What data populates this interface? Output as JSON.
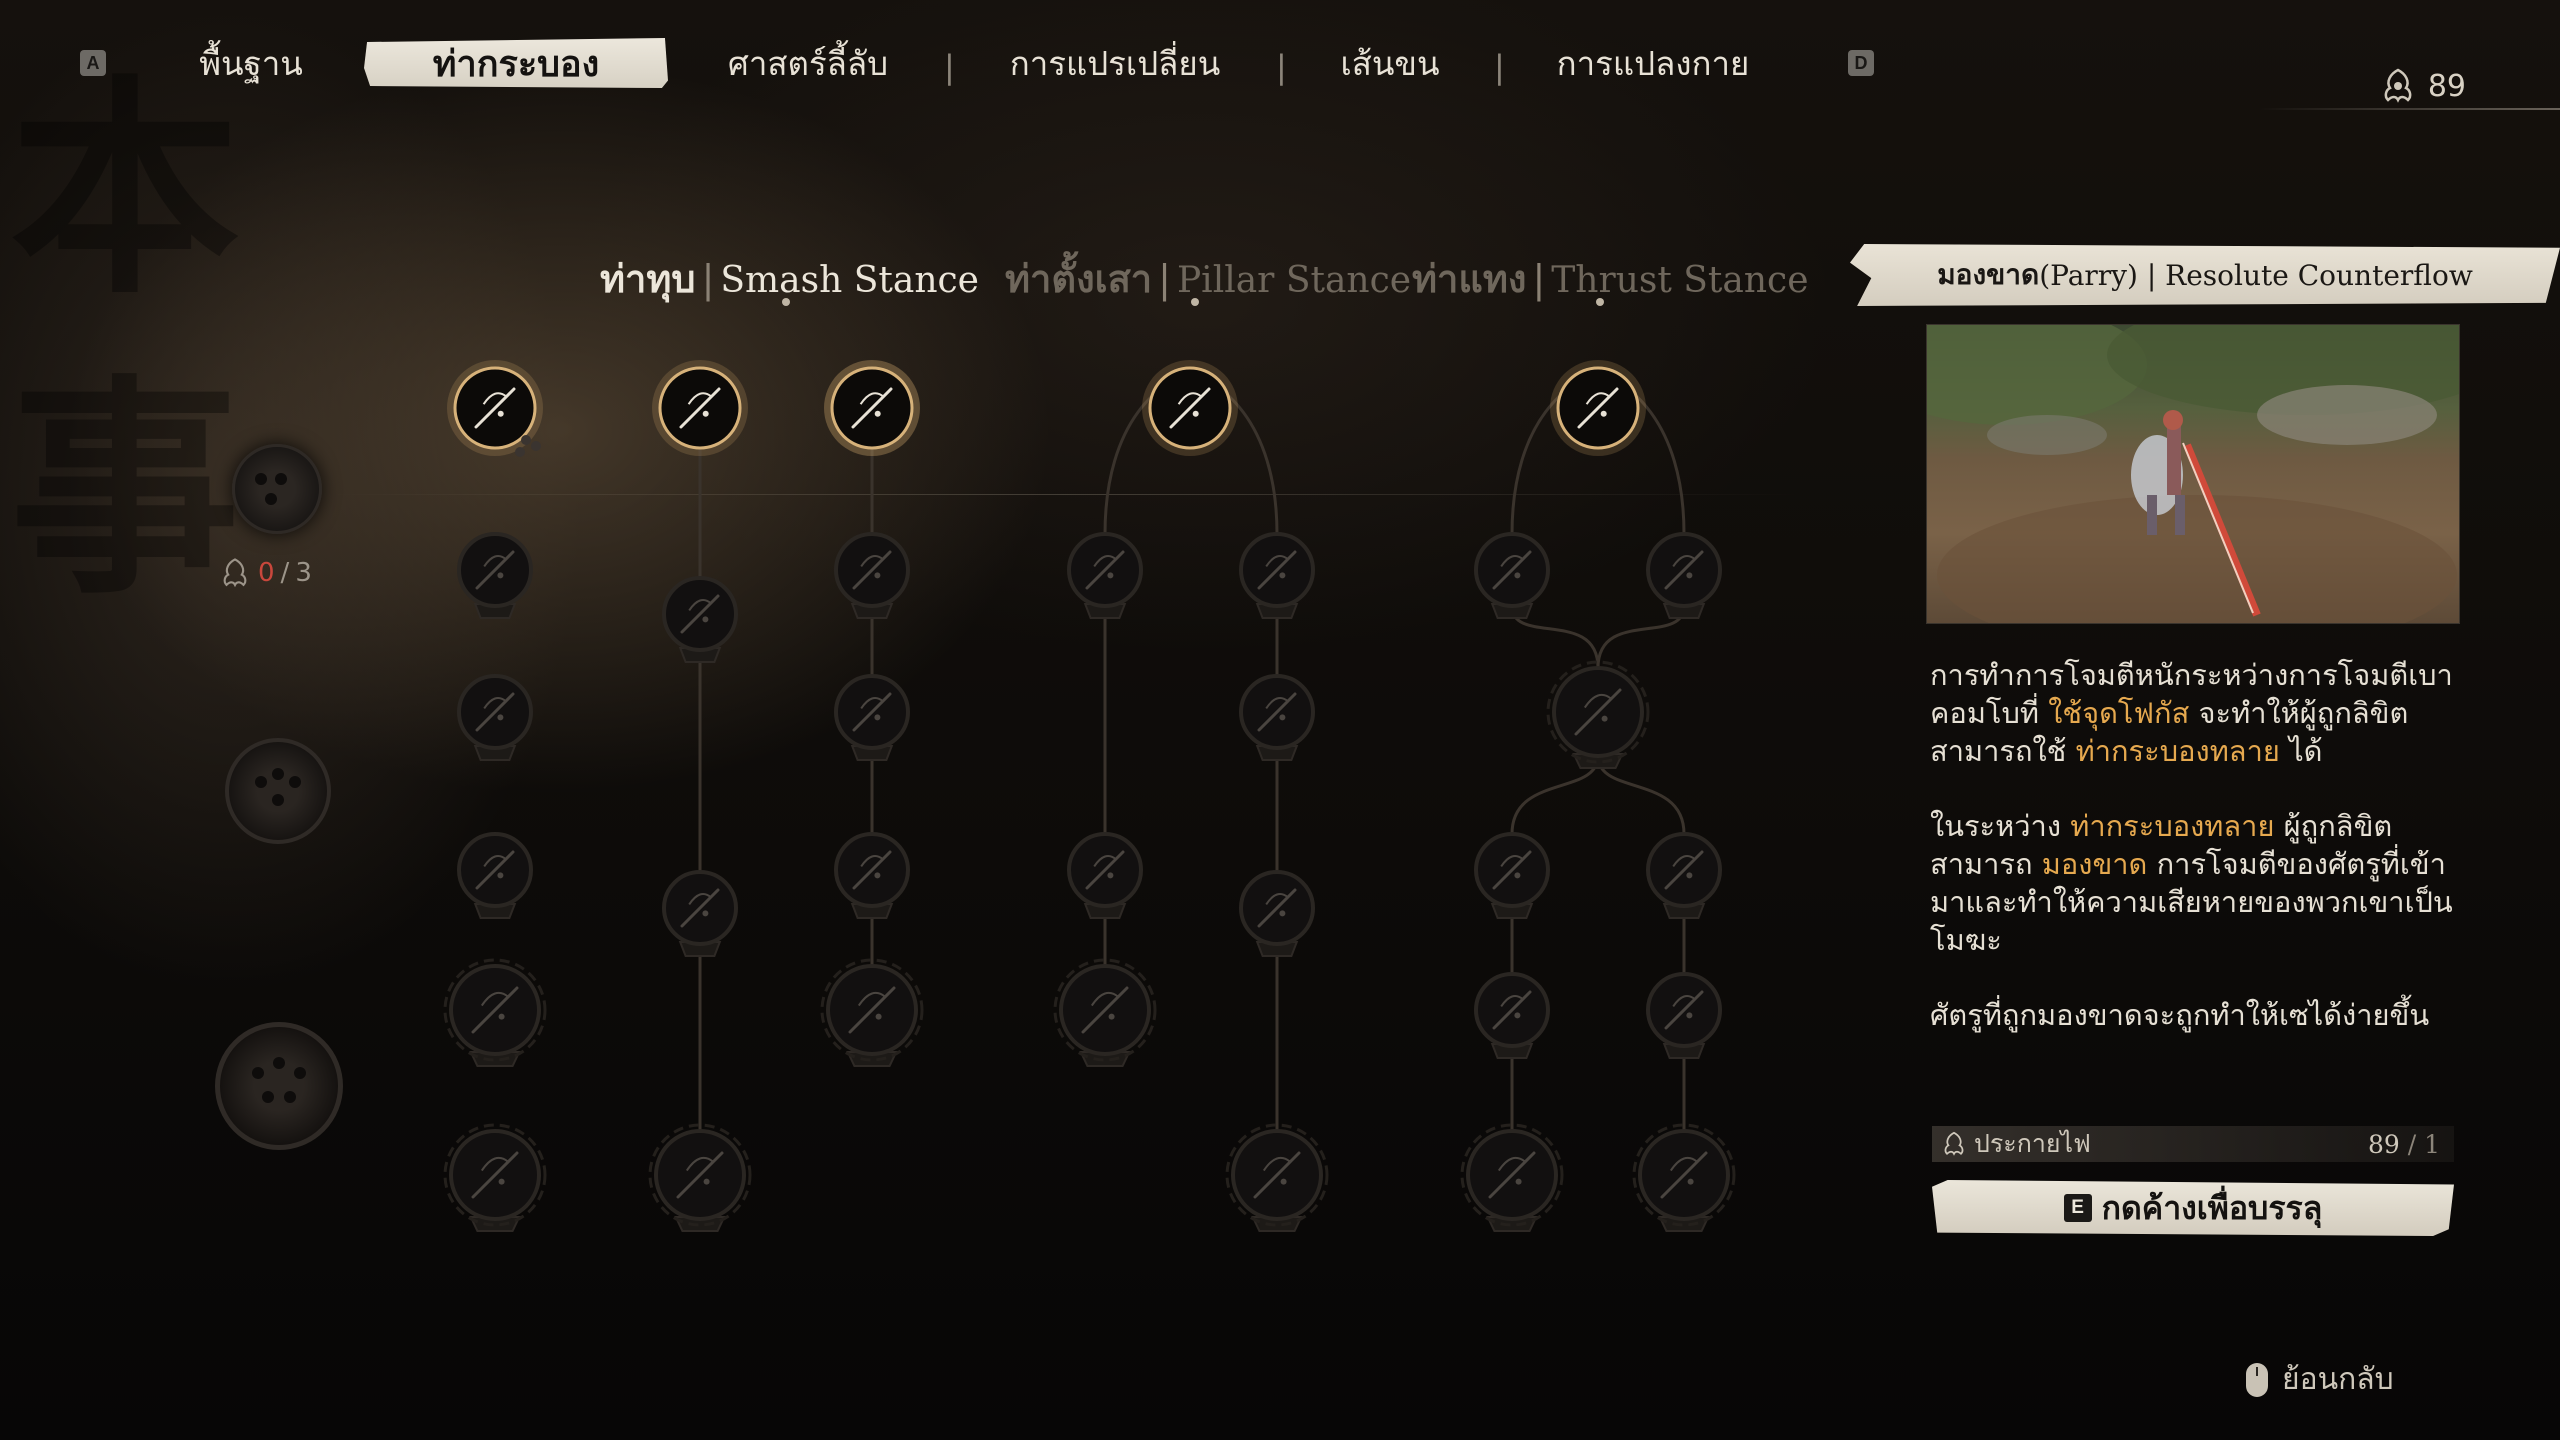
{
  "nav": {
    "left_key": "A",
    "right_key": "D",
    "tabs": [
      {
        "label": "พื้นฐาน",
        "active": false
      },
      {
        "label": "ท่ากระบอง",
        "active": true
      },
      {
        "label": "ศาสตร์ลี้ลับ",
        "active": false
      },
      {
        "label": "การแปรเปลี่ยน",
        "active": false
      },
      {
        "label": "เส้นขน",
        "active": false
      },
      {
        "label": "การแปลงกาย",
        "active": false
      }
    ],
    "separators": [
      "|",
      "|",
      "|"
    ],
    "currency": "89"
  },
  "stances": [
    {
      "th": "ท่าทุบ",
      "en": "Smash Stance",
      "active": true
    },
    {
      "th": "ท่าตั้งเสา",
      "en": "Pillar Stance",
      "active": false
    },
    {
      "th": "ท่าแทง",
      "en": "Thrust Stance",
      "active": false
    }
  ],
  "stance_separator": "|",
  "slots": {
    "count_current": "0",
    "count_sep": "/",
    "count_max": "3"
  },
  "tree": {
    "nodes": [
      {
        "id": "s1a",
        "state": "unlocked",
        "icon": "hook-icon"
      },
      {
        "id": "s1b",
        "state": "locked",
        "icon": "staff-strike-icon"
      },
      {
        "id": "s1c",
        "state": "locked",
        "icon": "sweep-icon"
      },
      {
        "id": "s1d",
        "state": "locked",
        "icon": "staff-swing-icon"
      },
      {
        "id": "s1e",
        "state": "locked",
        "icon": "whirl-icon"
      },
      {
        "id": "s1f",
        "state": "locked",
        "icon": "spiral-icon"
      },
      {
        "id": "s2a",
        "state": "unlocked",
        "icon": "wind-slash-icon"
      },
      {
        "id": "s2b",
        "state": "locked",
        "icon": "parry-icon"
      },
      {
        "id": "s2c",
        "state": "locked",
        "icon": "charge-icon"
      },
      {
        "id": "s2d",
        "state": "locked",
        "icon": "heavy-smash-icon"
      },
      {
        "id": "s3a",
        "state": "selected",
        "icon": "cross-staff-icon"
      },
      {
        "id": "s3b",
        "state": "locked",
        "icon": "deflect-icon"
      },
      {
        "id": "s3c",
        "state": "locked",
        "icon": "crescent-icon"
      },
      {
        "id": "s3d",
        "state": "locked",
        "icon": "impact-icon"
      },
      {
        "id": "s3e",
        "state": "locked",
        "icon": "crossed-blades-icon"
      },
      {
        "id": "p1",
        "state": "unlocked",
        "icon": "pillar-icon"
      },
      {
        "id": "p2a",
        "state": "locked",
        "icon": "pillar-stand-icon"
      },
      {
        "id": "p2b",
        "state": "locked",
        "icon": "pillar-leap-icon"
      },
      {
        "id": "p3a",
        "state": "locked",
        "icon": "pillar-vine-icon"
      },
      {
        "id": "p3b",
        "state": "locked",
        "icon": "pillar-spin-icon"
      },
      {
        "id": "p4a",
        "state": "locked",
        "icon": "pillar-kick-icon"
      },
      {
        "id": "p4b",
        "state": "locked",
        "icon": "pillar-fan-icon"
      },
      {
        "id": "p5a",
        "state": "locked",
        "icon": "pillar-dive-icon"
      },
      {
        "id": "p5b",
        "state": "locked",
        "icon": "pillar-star-icon"
      },
      {
        "id": "t1",
        "state": "unlocked",
        "icon": "thrust-icon"
      },
      {
        "id": "t2a",
        "state": "locked",
        "icon": "thrust-dash-icon"
      },
      {
        "id": "t2b",
        "state": "locked",
        "icon": "thrust-wave-icon"
      },
      {
        "id": "t3",
        "state": "locked",
        "icon": "thrust-lines-icon"
      },
      {
        "id": "t4a",
        "state": "locked",
        "icon": "thrust-burst-icon"
      },
      {
        "id": "t4b",
        "state": "locked",
        "icon": "thrust-swirl-icon"
      },
      {
        "id": "t5a",
        "state": "locked",
        "icon": "thrust-feather-icon"
      },
      {
        "id": "t5b",
        "state": "locked",
        "icon": "thrust-ring-icon"
      },
      {
        "id": "t6a",
        "state": "locked",
        "icon": "thrust-wave-big-icon"
      },
      {
        "id": "t6b",
        "state": "locked",
        "icon": "thrust-star-icon"
      }
    ]
  },
  "panel": {
    "title_th": "มองขาด",
    "title_paren": "(Parry)",
    "title_sep": "|",
    "title_en": "Resolute Counterflow",
    "desc": [
      {
        "parts": [
          {
            "t": "การทำการโจมตีหนักระหว่างการโจมตีเบาคอมโบที่ ",
            "hl": false
          },
          {
            "t": "ใช้จุดโฟกัส",
            "hl": true
          },
          {
            "t": " จะทำให้ผู้ถูกลิขิตสามารถใช้ ",
            "hl": false
          },
          {
            "t": "ท่ากระบองทลาย",
            "hl": true
          },
          {
            "t": " ได้",
            "hl": false
          }
        ]
      },
      {
        "parts": [
          {
            "t": "ในระหว่าง ",
            "hl": false
          },
          {
            "t": "ท่ากระบองทลาย",
            "hl": true
          },
          {
            "t": " ผู้ถูกลิขิตสามารถ ",
            "hl": false
          },
          {
            "t": "มองขาด",
            "hl": true
          },
          {
            "t": " การโจมตีของศัตรูที่เข้ามาและทำให้ความเสียหายของพวกเขาเป็นโมฆะ",
            "hl": false
          }
        ]
      },
      {
        "parts": [
          {
            "t": "ศัตรูที่ถูกมองขาดจะถูกทำให้เซได้ง่ายขึ้น",
            "hl": false
          }
        ]
      }
    ],
    "cost_label": "ประกายไฟ",
    "cost_have": "89",
    "cost_sep": "/",
    "cost_need": "1",
    "hold_key": "E",
    "hold_label": "กดค้างเพื่อบรรลุ"
  },
  "back_label": "ย้อนกลับ",
  "colors": {
    "accent": "#e6a94f",
    "ring_gold": "#c9a46a",
    "counter_red": "#c9473c"
  }
}
